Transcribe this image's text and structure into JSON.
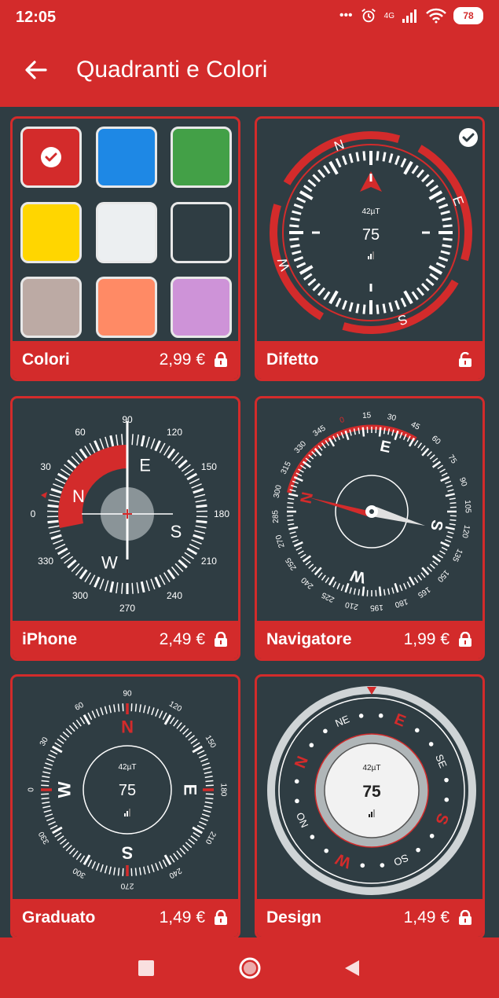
{
  "status": {
    "time": "12:05",
    "dots": "•••",
    "network": "4G",
    "battery": "78"
  },
  "appbar": {
    "title": "Quadranti e Colori"
  },
  "compass_values": {
    "field": "42µT",
    "heading": "75"
  },
  "cards": [
    {
      "name": "Colori",
      "price": "2,99 €",
      "locked": true
    },
    {
      "name": "Difetto",
      "price": "",
      "locked": false,
      "selected": true
    },
    {
      "name": "iPhone",
      "price": "2,49 €",
      "locked": true
    },
    {
      "name": "Navigatore",
      "price": "1,99 €",
      "locked": true
    },
    {
      "name": "Graduato",
      "price": "1,49 €",
      "locked": true
    },
    {
      "name": "Design",
      "price": "1,49 €",
      "locked": true
    }
  ],
  "swatch_colors": [
    "#d32b2b",
    "#1e88e5",
    "#43a047",
    "#ffd600",
    "#eceff1",
    "#2f3d43",
    "#bcaaa4",
    "#ff8a65",
    "#ce93d8"
  ],
  "iphone_dial": {
    "cardinals": [
      "N",
      "E",
      "S",
      "W"
    ],
    "degree_labels": [
      "0",
      "30",
      "60",
      "90",
      "120",
      "150",
      "180",
      "210",
      "240",
      "270",
      "300",
      "330"
    ]
  },
  "navigatore_dial": {
    "cardinals": [
      "N",
      "E",
      "S",
      "W"
    ],
    "degree_labels": [
      "0",
      "15",
      "30",
      "45",
      "60",
      "75",
      "90",
      "105",
      "120",
      "135",
      "150",
      "165",
      "180",
      "195",
      "210",
      "225",
      "240",
      "255",
      "270",
      "285",
      "300",
      "315",
      "330",
      "345"
    ]
  },
  "graduato_dial": {
    "cardinals": [
      "N",
      "E",
      "S",
      "W"
    ],
    "degree_labels": [
      "0",
      "30",
      "60",
      "90",
      "120",
      "150",
      "180",
      "210",
      "240",
      "270",
      "300",
      "330"
    ]
  },
  "design_dial": {
    "labels": [
      "N",
      "NE",
      "E",
      "SE",
      "S",
      "SO",
      "W",
      "NO"
    ]
  },
  "difetto_dial": {
    "cardinals": [
      "N",
      "E",
      "S",
      "W"
    ]
  },
  "colors": {
    "accent": "#d32b2b",
    "background": "#2f3d43",
    "white": "#ffffff"
  }
}
